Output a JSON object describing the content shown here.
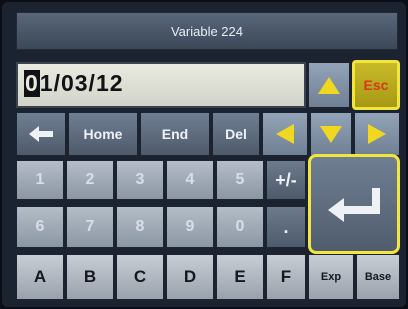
{
  "window": {
    "title": "Variable 224"
  },
  "entry": {
    "cursor_char": "0",
    "rest": "1/03/12"
  },
  "nav_row": {
    "home": "Home",
    "end": "End",
    "del": "Del"
  },
  "keys": {
    "esc": "Esc",
    "numbers_row1": [
      "1",
      "2",
      "3",
      "4",
      "5"
    ],
    "plus_minus": "+/-",
    "numbers_row2": [
      "6",
      "7",
      "8",
      "9",
      "0"
    ],
    "decimal": ".",
    "letters": [
      "A",
      "B",
      "C",
      "D",
      "E",
      "F"
    ],
    "exp": "Exp",
    "base": "Base"
  },
  "colors": {
    "highlight": "#f2e63d",
    "arrow": "#f0d820",
    "esc_text": "#d83a19"
  }
}
